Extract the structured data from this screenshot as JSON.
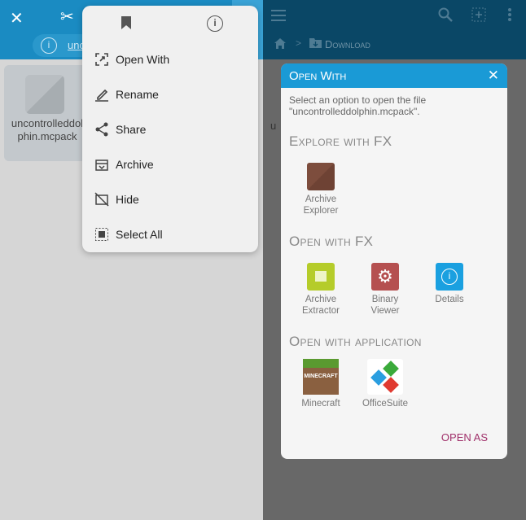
{
  "left": {
    "file_name": "uncontrolleddolphin.mcpack",
    "info_link": "unc",
    "menu": {
      "items": [
        {
          "label": "Open With",
          "icon": "open-with-icon"
        },
        {
          "label": "Rename",
          "icon": "pencil-icon"
        },
        {
          "label": "Share",
          "icon": "share-icon"
        },
        {
          "label": "Archive",
          "icon": "archive-icon"
        },
        {
          "label": "Hide",
          "icon": "hide-icon"
        },
        {
          "label": "Select All",
          "icon": "select-all-icon"
        }
      ]
    }
  },
  "right": {
    "breadcrumb": "Download",
    "behind_text": "u",
    "dialog": {
      "title": "Open With",
      "description": "Select an option to open the file \"uncontrolleddolphin.mcpack\".",
      "sections": [
        {
          "title": "Explore with FX",
          "apps": [
            {
              "label": "Archive Explorer",
              "color": "#7a4a3a"
            }
          ]
        },
        {
          "title": "Open with FX",
          "apps": [
            {
              "label": "Archive Extractor",
              "color": "#b5cc2a"
            },
            {
              "label": "Binary Viewer",
              "color": "#b55050"
            },
            {
              "label": "Details",
              "color": "#1aa0e0"
            }
          ]
        },
        {
          "title": "Open with application",
          "apps": [
            {
              "label": "Minecraft",
              "color": "#7a5a3a"
            },
            {
              "label": "OfficeSuite",
              "color": "#ffffff"
            }
          ]
        }
      ],
      "open_as": "OPEN AS"
    }
  },
  "colors": {
    "accent": "#1a9ad6",
    "open_as": "#a0306a"
  }
}
